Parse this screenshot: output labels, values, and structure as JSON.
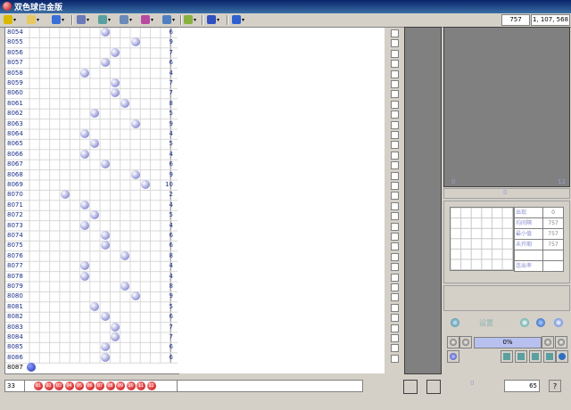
{
  "window": {
    "title": "双色球白金版"
  },
  "toolbar": {
    "buttons": [
      {
        "icon": "open-folder-icon",
        "color": "#d8b800"
      },
      {
        "icon": "folder-icon",
        "color": "#e8c860"
      },
      {
        "icon": "globe-icon",
        "color": "#3a6fd8"
      },
      {
        "icon": "chart-icon",
        "color": "#6a7ab8"
      },
      {
        "icon": "stack-icon",
        "color": "#5aa0a0"
      },
      {
        "icon": "grid-icon",
        "color": "#6a8ab8"
      },
      {
        "icon": "magnet-icon",
        "color": "#b84aa0"
      },
      {
        "icon": "filter-icon",
        "color": "#5080c0"
      },
      {
        "icon": "tools-icon",
        "color": "#8ab040"
      },
      {
        "icon": "link-icon",
        "color": "#3050c0"
      },
      {
        "icon": "help-icon",
        "color": "#3060d0"
      }
    ]
  },
  "status": {
    "count": "757",
    "range": "1, 107, 568"
  },
  "colors": {
    "ball": "#8e93d6",
    "red_ball": "#c80000",
    "label": "#1a2f8a"
  },
  "grid": {
    "rows": [
      {
        "label": "8054",
        "col": 8,
        "sum": "6"
      },
      {
        "label": "8055",
        "col": 11,
        "sum": "9"
      },
      {
        "label": "8056",
        "col": 9,
        "sum": "7"
      },
      {
        "label": "8057",
        "col": 8,
        "sum": "6"
      },
      {
        "label": "8058",
        "col": 6,
        "sum": "4"
      },
      {
        "label": "8059",
        "col": 9,
        "sum": "7"
      },
      {
        "label": "8060",
        "col": 9,
        "sum": "7"
      },
      {
        "label": "8061",
        "col": 10,
        "sum": "8"
      },
      {
        "label": "8062",
        "col": 7,
        "sum": "5"
      },
      {
        "label": "8063",
        "col": 11,
        "sum": "9"
      },
      {
        "label": "8064",
        "col": 6,
        "sum": "4"
      },
      {
        "label": "8065",
        "col": 7,
        "sum": "5"
      },
      {
        "label": "8066",
        "col": 6,
        "sum": "4"
      },
      {
        "label": "8067",
        "col": 8,
        "sum": "6"
      },
      {
        "label": "8068",
        "col": 11,
        "sum": "9"
      },
      {
        "label": "8069",
        "col": 12,
        "sum": "10"
      },
      {
        "label": "8070",
        "col": 4,
        "sum": "2"
      },
      {
        "label": "8071",
        "col": 6,
        "sum": "4"
      },
      {
        "label": "8072",
        "col": 7,
        "sum": "5"
      },
      {
        "label": "8073",
        "col": 6,
        "sum": "4"
      },
      {
        "label": "8074",
        "col": 8,
        "sum": "6"
      },
      {
        "label": "8075",
        "col": 8,
        "sum": "6"
      },
      {
        "label": "8076",
        "col": 10,
        "sum": "8"
      },
      {
        "label": "8077",
        "col": 6,
        "sum": "4"
      },
      {
        "label": "8078",
        "col": 6,
        "sum": "4"
      },
      {
        "label": "8079",
        "col": 10,
        "sum": "8"
      },
      {
        "label": "8080",
        "col": 11,
        "sum": "9"
      },
      {
        "label": "8081",
        "col": 7,
        "sum": "5"
      },
      {
        "label": "8082",
        "col": 8,
        "sum": "6"
      },
      {
        "label": "8083",
        "col": 9,
        "sum": "7"
      },
      {
        "label": "8084",
        "col": 9,
        "sum": "7"
      },
      {
        "label": "8085",
        "col": 8,
        "sum": "6"
      },
      {
        "label": "8086",
        "col": 8,
        "sum": "6"
      }
    ],
    "cursor_label": "8087"
  },
  "right_panel": {
    "top_left_label": "0",
    "top_right_label": "12",
    "strip_label": "0",
    "stats": [
      {
        "key": "出现",
        "value": "0"
      },
      {
        "key": "均间隔",
        "value": "757"
      },
      {
        "key": "最小值",
        "value": "757"
      },
      {
        "key": "未开期",
        "value": "757"
      },
      {
        "key": "",
        "value": ""
      },
      {
        "key": "连出率",
        "value": ""
      }
    ],
    "ctrl_label": "设置",
    "progress": "0%",
    "bottom_center": "0",
    "bottom_value": "65"
  },
  "bottom": {
    "count": "33",
    "red_balls": [
      "01",
      "02",
      "03",
      "04",
      "05",
      "06",
      "07",
      "08",
      "09",
      "10",
      "11",
      "12"
    ]
  }
}
